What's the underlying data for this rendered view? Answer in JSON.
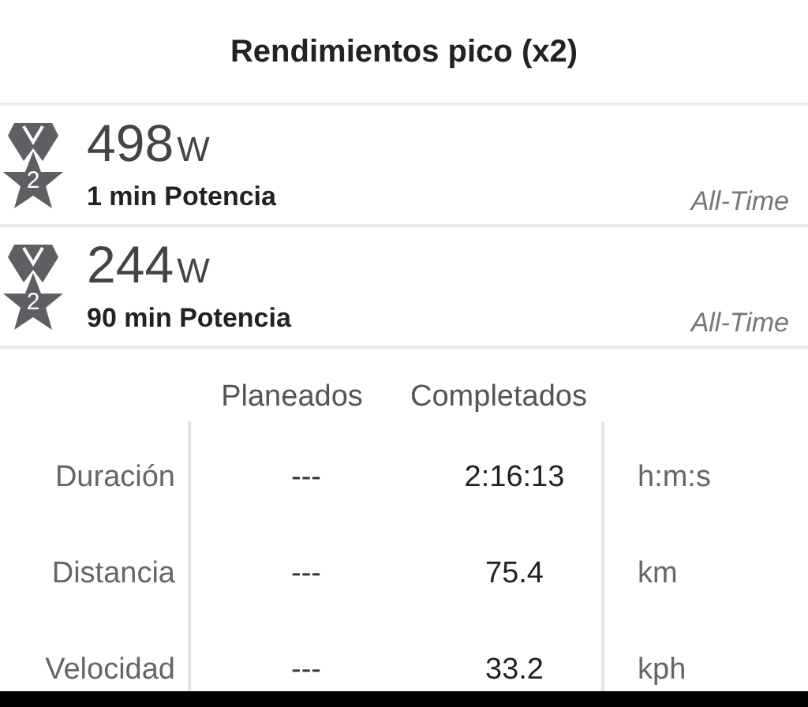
{
  "title": "Rendimientos pico (x2)",
  "peaks": [
    {
      "rank": "2",
      "value": "498",
      "unit": "W",
      "label": "1 min Potencia",
      "period": "All-Time"
    },
    {
      "rank": "2",
      "value": "244",
      "unit": "W",
      "label": "90 min Potencia",
      "period": "All-Time"
    }
  ],
  "table": {
    "columns": [
      "Planeados",
      "Completados"
    ],
    "rows": [
      {
        "label": "Duración",
        "planned": "---",
        "completed": "2:16:13",
        "unit": "h:m:s"
      },
      {
        "label": "Distancia",
        "planned": "---",
        "completed": "75.4",
        "unit": "km"
      },
      {
        "label": "Velocidad",
        "planned": "---",
        "completed": "33.2",
        "unit": "kph"
      }
    ]
  }
}
